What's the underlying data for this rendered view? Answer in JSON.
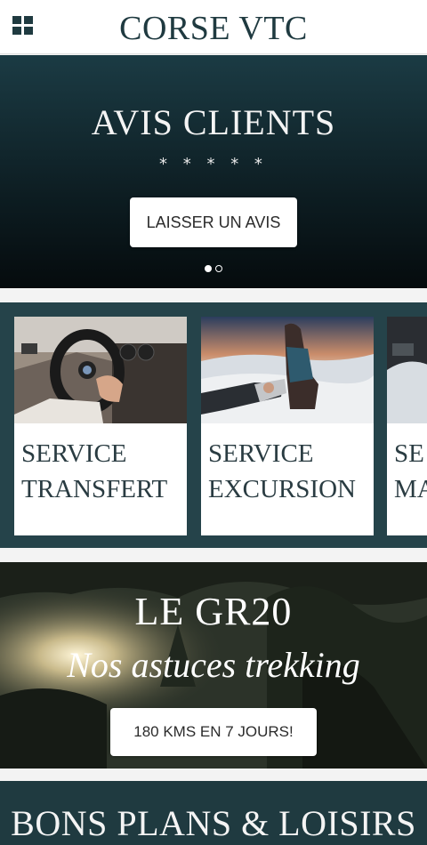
{
  "header": {
    "menu_icon": "grid-menu-icon",
    "title": "CORSE VTC"
  },
  "hero": {
    "title": "AVIS CLIENTS",
    "stars": "* * * * *",
    "button_label": "LAISSER UN AVIS",
    "carousel": {
      "slides": 2,
      "active": 1
    }
  },
  "services": {
    "cards": [
      {
        "label_line1": "SERVICE",
        "label_line2": "TRANSFERT"
      },
      {
        "label_line1": "SERVICE",
        "label_line2": "EXCURSION"
      },
      {
        "label_line1": "SE",
        "label_line2": "MA"
      }
    ]
  },
  "gr20": {
    "title": "LE GR20",
    "subtitle": "Nos astuces trekking",
    "button_label": "180 KMS EN 7 JOURS!"
  },
  "bons_plans": {
    "title": "BONS PLANS  & LOISIRS"
  },
  "colors": {
    "brand_dark": "#1f3a40",
    "services_bg": "#25434a",
    "button_bg": "#ffffff"
  }
}
